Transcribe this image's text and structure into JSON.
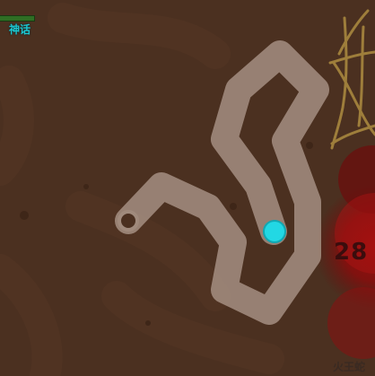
{
  "hud": {
    "player_name": "神话",
    "player_hp_fraction": 0.9
  },
  "boss": {
    "level": "28",
    "name": "火王蛇"
  },
  "colors": {
    "ground": "#4b3020",
    "trail": "#a08a7c",
    "player": "#22d8e4",
    "boss_glow": "#9b0d0d",
    "web": "#a8873e",
    "name_text": "#1ec7d0"
  },
  "icons": {
    "player": "player-dot-icon",
    "trail_end": "trail-start-ring-icon",
    "web": "spider-web-icon"
  }
}
